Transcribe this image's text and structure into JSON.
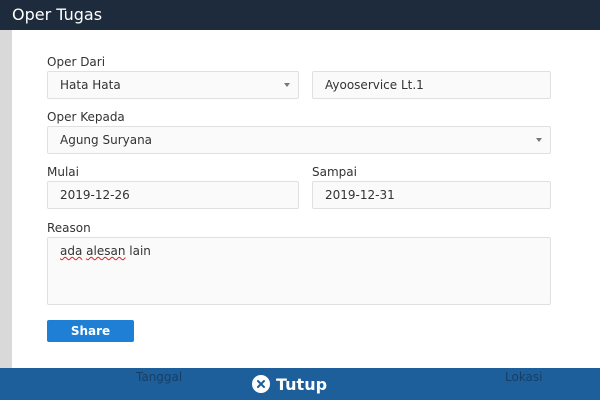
{
  "dialog": {
    "title": "Oper Tugas"
  },
  "form": {
    "oper_dari_label": "Oper Dari",
    "oper_dari_user": "Hata Hata",
    "oper_dari_location": "Ayooservice Lt.1",
    "oper_kepada_label": "Oper Kepada",
    "oper_kepada_user": "Agung Suryana",
    "mulai_label": "Mulai",
    "mulai_value": "2019-12-26",
    "sampai_label": "Sampai",
    "sampai_value": "2019-12-31",
    "reason_label": "Reason",
    "reason_value_word1": "ada",
    "reason_value_word2": "alesan",
    "reason_value_word3": "lain",
    "share_label": "Share"
  },
  "bottom_bar": {
    "left_label": "Tanggal",
    "right_label": "Lokasi",
    "close_label": "Tutup",
    "close_icon": "close-circle-icon"
  },
  "colors": {
    "title_bar": "#1e2b3c",
    "primary_button": "#1f7fd4",
    "bottom_bar": "#1d5f9a"
  }
}
